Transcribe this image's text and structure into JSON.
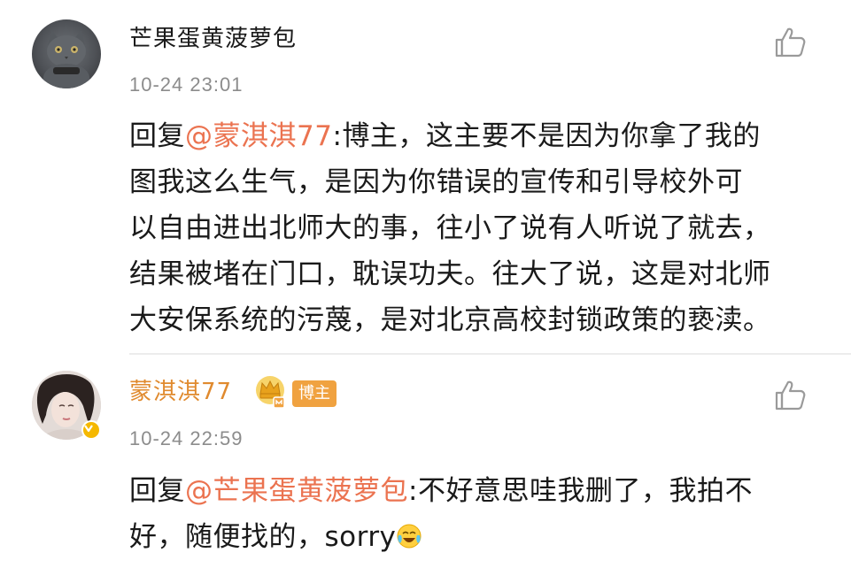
{
  "comments": [
    {
      "username": "芒果蛋黄菠萝包",
      "timestamp": "10-24 23:01",
      "reply_prefix": "回复",
      "mention": "@蒙淇淇77",
      "text_lines": [
        ":博主，这主要不是因为你拿了我的",
        "图我这么生气，是因为你错误的宣传和引导校外可",
        "以自由进出北师大的事，往小了说有人听说了就去，",
        "结果被堵在门口，耽误功夫。往大了说，这是对北师",
        "大安保系统的污蔑，是对北京高校封锁政策的亵渎。"
      ]
    },
    {
      "username": "蒙淇淇77",
      "badge_label": "博主",
      "timestamp": "10-24 22:59",
      "reply_prefix": "回复",
      "mention": "@芒果蛋黄菠萝包",
      "text_line1": ":不好意思哇我删了，我拍不",
      "text_line2": "好，随便找的，sorry"
    }
  ],
  "colors": {
    "mention": "#eb7350",
    "author_name": "#e08a2e",
    "timestamp": "#8c8c8c",
    "badge_bg": "#f0a240"
  },
  "icons": [
    "thumbs-up-icon",
    "crown-icon",
    "verified-icon",
    "laughing-crying-emoji-icon"
  ]
}
